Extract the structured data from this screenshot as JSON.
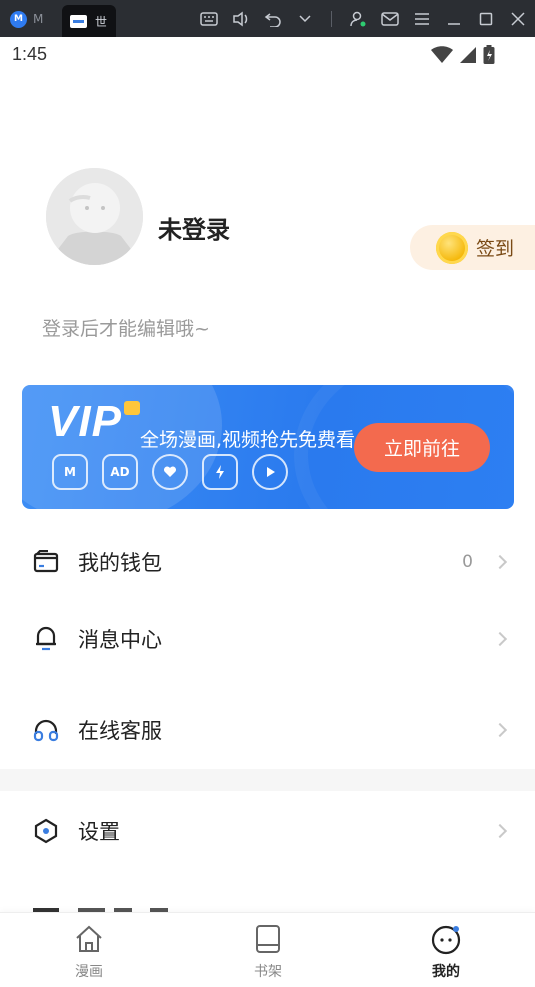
{
  "emulator": {
    "tab1_label": "M",
    "tab1_icon": "app-logo-icon",
    "tab2_label": "世",
    "tab2_icon": "app-window-icon",
    "controls": [
      "keyboard-icon",
      "volume-icon",
      "undo-icon",
      "chevron-down-icon",
      "account-icon",
      "mail-icon",
      "menu-icon",
      "minimize-icon",
      "maximize-icon",
      "close-icon"
    ]
  },
  "status_bar": {
    "time": "1:45",
    "icons": [
      "wifi-icon",
      "signal-icon",
      "battery-icon"
    ]
  },
  "profile": {
    "username": "未登录",
    "hint": "登录后才能编辑哦~",
    "signin_label": "签到"
  },
  "vip_banner": {
    "title": "VIP",
    "slogan": "全场漫画,视频抢先免费看",
    "button_label": "立即前往",
    "perk_icons": [
      "manga-icon",
      "ad-free-icon",
      "heart-icon",
      "lightning-crown-icon",
      "play-icon"
    ],
    "perk_icon_text": [
      "M",
      "AD",
      "",
      "",
      ""
    ],
    "accent": "#2a7aee",
    "button_color": "#f36a4e"
  },
  "menu": {
    "wallet_label": "我的钱包",
    "wallet_value": "0",
    "messages_label": "消息中心",
    "service_label": "在线客服",
    "settings_label": "设置"
  },
  "bottom_nav": {
    "items": [
      {
        "label": "漫画",
        "icon": "home-icon",
        "active": false
      },
      {
        "label": "书架",
        "icon": "bookshelf-icon",
        "active": false
      },
      {
        "label": "我的",
        "icon": "profile-face-icon",
        "active": true
      }
    ]
  }
}
